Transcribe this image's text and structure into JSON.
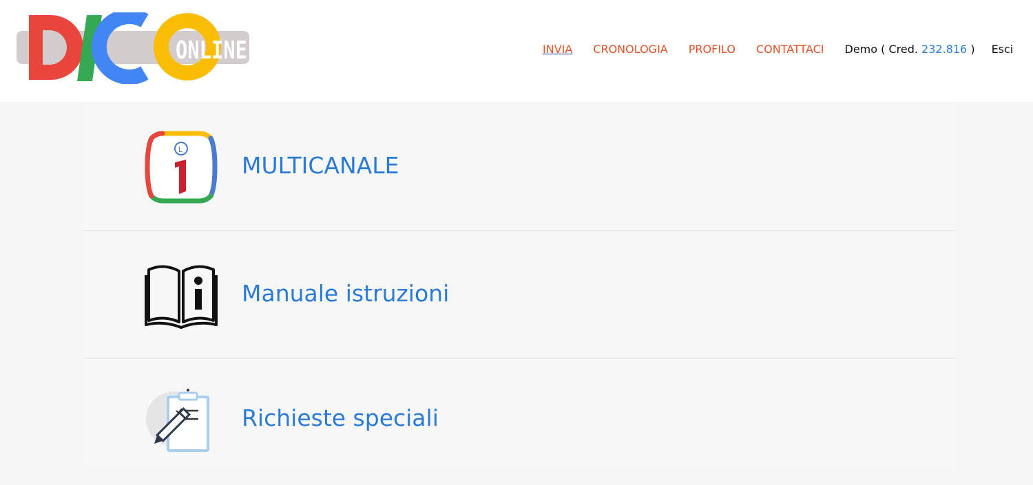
{
  "logo": {
    "letters": [
      "D",
      "I",
      "C",
      "O"
    ],
    "suffix": "ONLINE"
  },
  "nav": {
    "items": [
      {
        "label": "INVIA",
        "active": true
      },
      {
        "label": "CRONOLOGIA",
        "active": false
      },
      {
        "label": "PROFILO",
        "active": false
      },
      {
        "label": "CONTATTACI",
        "active": false
      }
    ],
    "user_prefix": "Demo ( Cred.",
    "credits": "232.816",
    "user_suffix": ")",
    "logout": "Esci"
  },
  "menu": {
    "items": [
      {
        "label": "MULTICANALE",
        "icon": "info-badge-icon"
      },
      {
        "label": "Manuale istruzioni",
        "icon": "manual-book-icon"
      },
      {
        "label": "Richieste speciali",
        "icon": "clipboard-pen-icon"
      }
    ]
  },
  "colors": {
    "nav_link": "#e0522a",
    "accent_blue": "#2a7ad8",
    "logo_red": "#e8453c",
    "logo_green": "#34a853",
    "logo_blue": "#4285f4",
    "logo_yellow": "#fbbc05"
  }
}
